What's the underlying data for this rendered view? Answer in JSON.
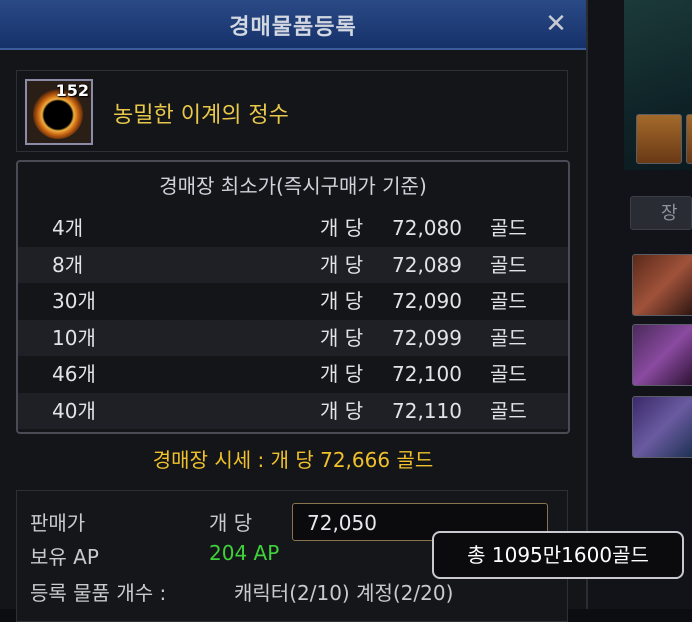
{
  "dialog": {
    "title": "경매물품등록",
    "close_symbol": "✕"
  },
  "item": {
    "name": "농밀한 이계의 정수",
    "count": "152",
    "icon": "dark-orb-icon"
  },
  "listings": {
    "header": "경매장 최소가(즉시구매가 기준)",
    "rows": [
      {
        "qty": "4개",
        "unit": "개 당",
        "price": "72,080",
        "gold": "골드"
      },
      {
        "qty": "8개",
        "unit": "개 당",
        "price": "72,089",
        "gold": "골드"
      },
      {
        "qty": "30개",
        "unit": "개 당",
        "price": "72,090",
        "gold": "골드"
      },
      {
        "qty": "10개",
        "unit": "개 당",
        "price": "72,099",
        "gold": "골드"
      },
      {
        "qty": "46개",
        "unit": "개 당",
        "price": "72,100",
        "gold": "골드"
      },
      {
        "qty": "40개",
        "unit": "개 당",
        "price": "72,110",
        "gold": "골드"
      }
    ]
  },
  "market_price": "경매장 시세 : 개 당 72,666 골드",
  "form": {
    "sell_price_label": "판매가",
    "per_unit_label": "개 당",
    "sell_price_value": "72,050",
    "ap_label": "보유 AP",
    "ap_value": "204 AP",
    "registered_label": "등록 물품 개수 :",
    "registered_value": "캐릭터(2/10) 계정(2/20)"
  },
  "tooltip": {
    "total": "총 1095만1600골드"
  },
  "background": {
    "tab_text": "장"
  },
  "colors": {
    "title_bar": "#1e3c78",
    "item_name": "#e8c84a",
    "market_price": "#f0c12a",
    "ap_value": "#3fd23a"
  }
}
